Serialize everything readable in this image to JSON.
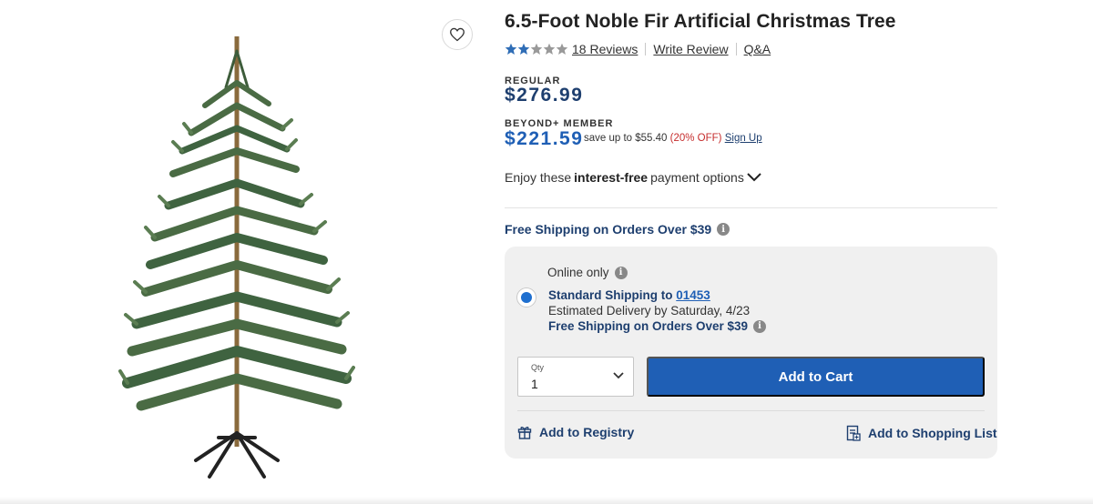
{
  "product": {
    "title": "6.5-Foot Noble Fir Artificial Christmas Tree",
    "rating": {
      "stars_filled": 2,
      "stars_total": 5,
      "star_color": "#2f6db6",
      "star_empty_color": "#999999"
    },
    "reviews_label": "18 Reviews",
    "write_review_label": "Write Review",
    "qa_label": "Q&A",
    "favorite_icon": "heart-icon"
  },
  "pricing": {
    "regular_label": "REGULAR",
    "regular_price": "$276.99",
    "member_label": "BEYOND+ MEMBER",
    "member_price": "$221.59",
    "save_text": "save up to $55.40",
    "off_text": "(20% OFF)",
    "signup_label": "Sign Up"
  },
  "finance": {
    "prefix": "Enjoy these",
    "bold": "interest-free",
    "suffix": "payment options"
  },
  "shipping": {
    "banner": "Free Shipping on Orders Over $39",
    "online_only": "Online only",
    "standard_prefix": "Standard Shipping to",
    "zip": "01453",
    "estimate": "Estimated Delivery by Saturday, 4/23",
    "free_line": "Free Shipping on Orders Over $39"
  },
  "purchase": {
    "qty_label": "Qty",
    "qty_value": "1",
    "add_to_cart": "Add to Cart",
    "add_to_registry": "Add to Registry",
    "add_to_list": "Add to Shopping List"
  },
  "colors": {
    "navy": "#1e3f6f",
    "button_blue": "#1f5fb5",
    "sale_red": "#c62d2d",
    "card_gray": "#f0f0f0"
  }
}
